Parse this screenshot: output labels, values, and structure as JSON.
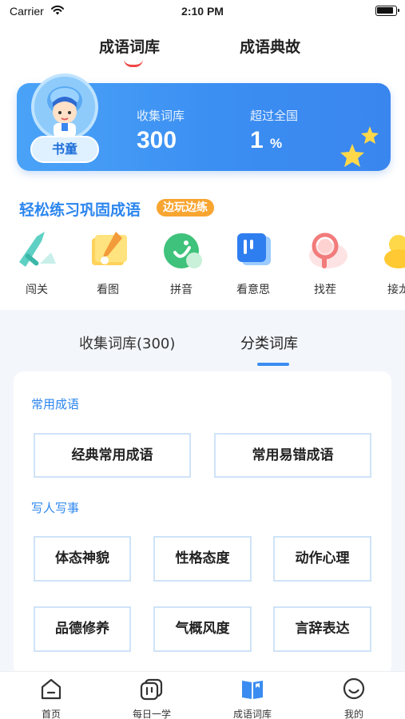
{
  "status_bar": {
    "carrier": "Carrier",
    "time": "2:10 PM"
  },
  "top_tabs": [
    {
      "label": "成语词库",
      "active": true
    },
    {
      "label": "成语典故",
      "active": false
    }
  ],
  "stats": {
    "avatar_badge": "书童",
    "collected_label": "收集词库",
    "collected_value": "300",
    "beat_label": "超过全国",
    "beat_value": "1",
    "beat_unit": "%"
  },
  "practice": {
    "title": "轻松练习巩固成语",
    "tag": "边玩边练",
    "games": [
      {
        "label": "闯关",
        "icon": "sword-icon"
      },
      {
        "label": "看图",
        "icon": "picture-icon"
      },
      {
        "label": "拼音",
        "icon": "pinyin-icon"
      },
      {
        "label": "看意思",
        "icon": "meaning-icon"
      },
      {
        "label": "找茬",
        "icon": "magnifier-icon"
      },
      {
        "label": "接龙",
        "icon": "chain-icon"
      }
    ]
  },
  "sub_tabs": [
    {
      "label": "收集词库(300)",
      "active": false
    },
    {
      "label": "分类词库",
      "active": true
    }
  ],
  "categories": {
    "section1": {
      "title": "常用成语",
      "items": [
        "经典常用成语",
        "常用易错成语"
      ]
    },
    "section2": {
      "title": "写人写事",
      "items": [
        "体态神貌",
        "性格态度",
        "动作心理",
        "品德修养",
        "气概风度",
        "言辞表达"
      ]
    }
  },
  "bottom_nav": [
    {
      "label": "首页",
      "icon": "home-icon",
      "active": false
    },
    {
      "label": "每日一学",
      "icon": "daily-icon",
      "active": false
    },
    {
      "label": "成语词库",
      "icon": "book-icon",
      "active": true
    },
    {
      "label": "我的",
      "icon": "smile-icon",
      "active": false
    }
  ],
  "colors": {
    "accent": "#3a8cf0",
    "tag": "#f8a531",
    "indicator_red": "#f04545"
  }
}
